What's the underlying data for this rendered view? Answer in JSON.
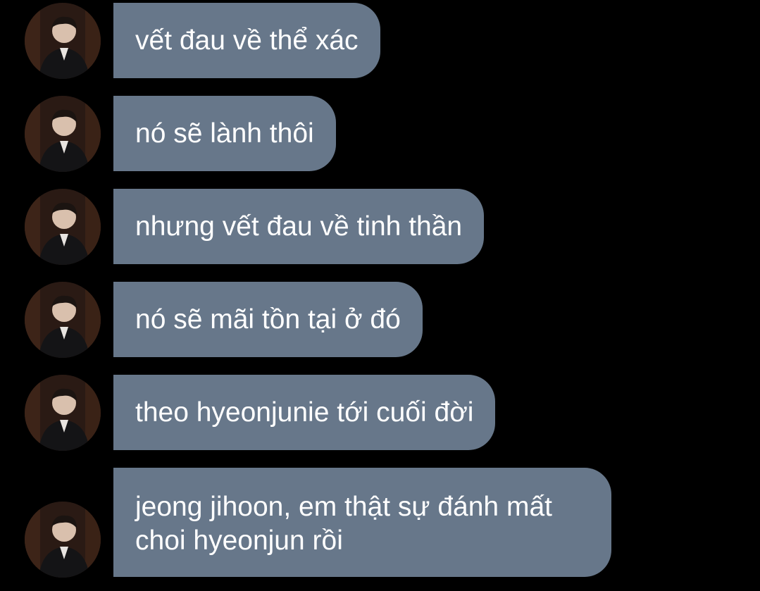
{
  "theme": {
    "background": "#000000",
    "bubble_color": "#67778a",
    "text_color": "#ffffff"
  },
  "messages": [
    {
      "sender_avatar": "avatar-photo",
      "lines": [
        "vết đau về thể xác"
      ]
    },
    {
      "sender_avatar": "avatar-photo",
      "lines": [
        "nó sẽ lành thôi"
      ]
    },
    {
      "sender_avatar": "avatar-photo",
      "lines": [
        "nhưng vết đau về tinh thần"
      ]
    },
    {
      "sender_avatar": "avatar-photo",
      "lines": [
        "nó sẽ mãi tồn tại ở đó"
      ]
    },
    {
      "sender_avatar": "avatar-photo",
      "lines": [
        "theo hyeonjunie tới cuối đời"
      ]
    },
    {
      "sender_avatar": "avatar-photo",
      "lines": [
        "jeong jihoon, em thật sự đánh mất",
        "choi hyeonjun rồi"
      ]
    }
  ]
}
